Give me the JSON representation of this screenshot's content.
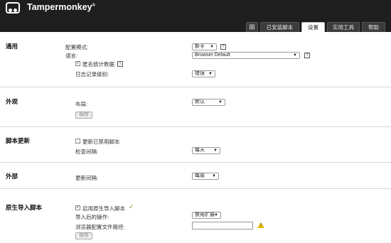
{
  "app": {
    "title": "Tampermonkey",
    "trademark": "®"
  },
  "tabs": [
    {
      "label": "⊞"
    },
    {
      "label": "已安装脚本"
    },
    {
      "label": "设置"
    },
    {
      "label": "实用工具"
    },
    {
      "label": "帮助"
    }
  ],
  "general": {
    "title": "通用",
    "config_mode_label": "配置模式:",
    "config_mode_value": "新手",
    "language_label": "语言:",
    "language_value": "Browser Default",
    "anon_stats_label": "匿名统计数据",
    "log_level_label": "日志记录级别:",
    "log_level_value": "错误"
  },
  "appearance": {
    "title": "外观",
    "layout_label": "布局:",
    "layout_value": "默认",
    "save_label": "保存"
  },
  "script_update": {
    "title": "脚本更新",
    "update_disabled_label": "更新已禁用脚本",
    "check_interval_label": "检查间隔:",
    "check_interval_value": "每天"
  },
  "external": {
    "title": "外部",
    "update_interval_label": "更新间隔:",
    "update_interval_value": "每周"
  },
  "native_import": {
    "title": "原生导入脚本",
    "enable_label": "启用原生导入脚本",
    "after_import_label": "导入后的操作:",
    "after_import_value": "禁用扩展",
    "browser_config_path_label": "浏览器配置文件路径:",
    "browser_config_path_value": "",
    "save_label": "保存"
  }
}
